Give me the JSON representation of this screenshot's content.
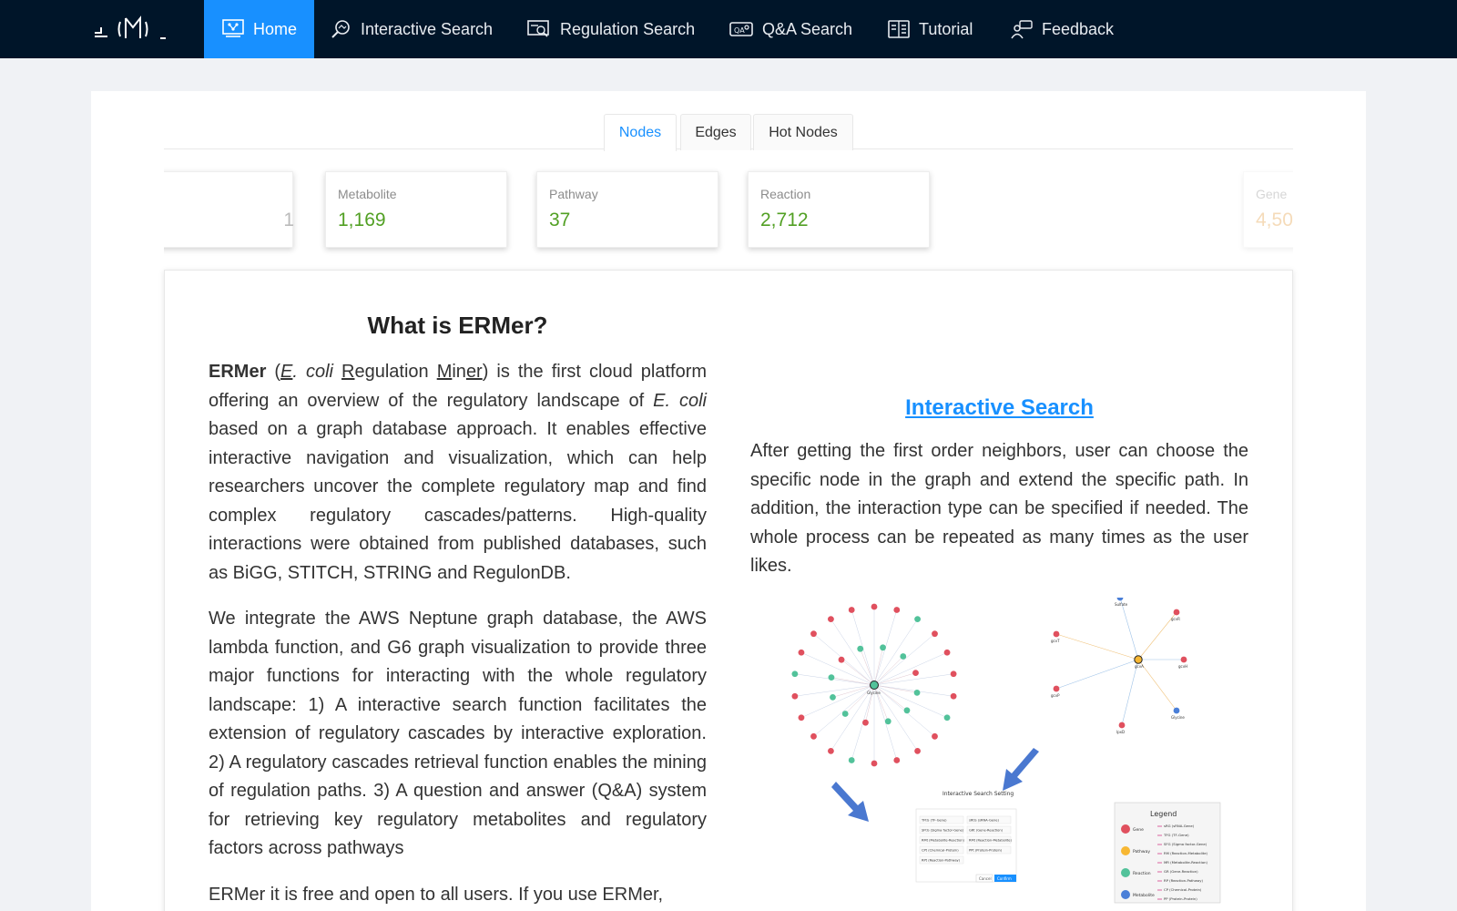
{
  "nav": {
    "items": [
      {
        "label": "Home",
        "icon": "home-dashboard-icon",
        "active": true
      },
      {
        "label": "Interactive Search",
        "icon": "magnify-graph-icon"
      },
      {
        "label": "Regulation Search",
        "icon": "monitor-search-icon"
      },
      {
        "label": "Q&A Search",
        "icon": "qa-chat-icon"
      },
      {
        "label": "Tutorial",
        "icon": "book-icon"
      },
      {
        "label": "Feedback",
        "icon": "feedback-person-icon"
      }
    ]
  },
  "tabs": [
    "Nodes",
    "Edges",
    "Hot Nodes"
  ],
  "stats": [
    {
      "label": "",
      "value": "1"
    },
    {
      "label": "Metabolite",
      "value": "1,169"
    },
    {
      "label": "Pathway",
      "value": "37"
    },
    {
      "label": "Reaction",
      "value": "2,712"
    },
    {
      "label": "Gene",
      "value": "4,50"
    }
  ],
  "about": {
    "heading": "What is ERMer?",
    "p1_brand": "ERMer",
    "p1_e": "E",
    "p1_coli": ". coli",
    "p1_r": "R",
    "p1_egulation": "egulation",
    "p1_m": "M",
    "p1_in": "in",
    "p1_er": "er",
    "p1_rest1": ") is the first cloud platform offering an overview of the regulatory landscape of ",
    "p1_ecoli": "E. coli",
    "p1_rest2": " based on a graph database approach. It enables effective interactive navigation and visualization, which can help researchers uncover the complete regulatory map and find complex regulatory cascades/patterns. High-quality interactions were obtained from published databases, such as BiGG, STITCH, STRING and RegulonDB.",
    "p2": "We integrate the AWS Neptune graph database, the AWS lambda function, and G6 graph visualization to provide three major functions for interacting with the whole regulatory landscape: 1) A interactive search function facilitates the extension of regulatory cascades by interactive exploration. 2) A regulatory cascades retrieval function enables the mining of regulation paths. 3) A question and answer (Q&A) system for retrieving key regulatory metabolites and regulatory factors across pathways",
    "p3": "ERMer it is free and open to all users. If you use ERMer,"
  },
  "interactive": {
    "heading": "Interactive Search",
    "text": "After getting the first order neighbors, user can choose the specific node in the graph and extend the specific path. In addition, the interaction type can be specified if needed. The whole process can be repeated as many times as the user likes."
  },
  "figure": {
    "center_label": "Glycine",
    "right_center_label": "gcvA",
    "right_nodes": [
      "Sulfate",
      "gcvR",
      "gcvH",
      "gcvT",
      "gcvP",
      "Glycine",
      "lpxD"
    ],
    "setting_title": "Interactive Search Setting",
    "setting_tags": [
      "TFtG (TF-Gene)",
      "sRtG (sRNA-Gene)",
      "SFtG (Sigma factor-Gene)",
      "GRt (Gene-Reaction)",
      "RMt (Metabolite-Reaction)",
      "RMt (Reaction-Metabolite)",
      "CPt (Chemical-Protein)",
      "PPt (Protein-Protein)",
      "RPt (Reaction-Pathway)"
    ],
    "setting_cancel": "Cancel",
    "setting_confirm": "Confirm",
    "legend_title": "Legend",
    "legend_nodes": [
      "Gene",
      "Pathway",
      "Reaction",
      "Metabolite"
    ],
    "legend_edges": [
      "sRG (sRNA-Gene)",
      "TFG (TF-Gene)",
      "SFG (Sigma factor-Gene)",
      "RM (Reaction-Metabolite)",
      "MR (Metabolite-Reaction)",
      "GR (Gene-Reaction)",
      "RP (Reaction-Pathway)",
      "CP (Chemical-Protein)",
      "PP (Protein-Protein)"
    ],
    "colors": {
      "gene": "#e0505e",
      "pathway": "#f7b733",
      "reaction": "#52c29a",
      "metabolite": "#4a7fd8",
      "arrow": "#4a78d0"
    }
  }
}
